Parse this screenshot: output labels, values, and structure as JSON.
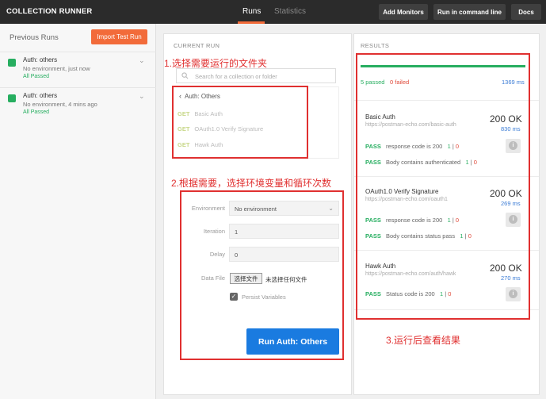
{
  "app": {
    "title": "COLLECTION RUNNER"
  },
  "tabs": {
    "runs": "Runs",
    "statistics": "Statistics"
  },
  "top_buttons": {
    "add_monitors": "Add Monitors",
    "run_cmd": "Run in command line",
    "docs": "Docs"
  },
  "sidebar": {
    "heading": "Previous Runs",
    "import_label": "Import Test Run",
    "runs": [
      {
        "name": "Auth: others",
        "env": "No environment, just now",
        "status": "All Passed"
      },
      {
        "name": "Auth: others",
        "env": "No environment, 4 mins ago",
        "status": "All Passed"
      }
    ]
  },
  "current_run": {
    "label": "CURRENT RUN",
    "search_placeholder": "Search for a collection or folder",
    "folder": "Auth: Others",
    "requests": [
      {
        "method": "GET",
        "name": "Basic Auth"
      },
      {
        "method": "GET",
        "name": "OAuth1.0 Verify Signature"
      },
      {
        "method": "GET",
        "name": "Hawk Auth"
      }
    ],
    "form": {
      "environment_label": "Environment",
      "environment_value": "No environment",
      "iteration_label": "Iteration",
      "iteration_value": "1",
      "delay_label": "Delay",
      "delay_value": "0",
      "datafile_label": "Data File",
      "choose_file": "选择文件",
      "no_file": "未选择任何文件",
      "persist_label": "Persist Variables",
      "persist_checked": true
    },
    "run_button": "Run Auth: Others"
  },
  "results": {
    "label": "RESULTS",
    "passed": "5 passed",
    "failed": "0 failed",
    "total_time": "1369 ms",
    "items": [
      {
        "name": "Basic Auth",
        "url": "https://postman-echo.com/basic-auth",
        "code": "200 OK",
        "time": "830 ms",
        "tests": [
          {
            "status": "PASS",
            "name": "response code is 200",
            "pass_count": "1",
            "fail_count": "0"
          },
          {
            "status": "PASS",
            "name": "Body contains authenticated",
            "pass_count": "1",
            "fail_count": "0"
          }
        ]
      },
      {
        "name": "OAuth1.0 Verify Signature",
        "url": "https://postman-echo.com/oauth1",
        "code": "200 OK",
        "time": "269 ms",
        "tests": [
          {
            "status": "PASS",
            "name": "response code is 200",
            "pass_count": "1",
            "fail_count": "0"
          },
          {
            "status": "PASS",
            "name": "Body contains status pass",
            "pass_count": "1",
            "fail_count": "0"
          }
        ]
      },
      {
        "name": "Hawk Auth",
        "url": "https://postman-echo.com/auth/hawk",
        "code": "200 OK",
        "time": "270 ms",
        "tests": [
          {
            "status": "PASS",
            "name": "Status code is 200",
            "pass_count": "1",
            "fail_count": "0"
          }
        ]
      }
    ]
  },
  "annotations": {
    "step1": "1.选择需要运行的文件夹",
    "step2": "2.根据需要，选择环境变量和循环次数",
    "step3": "3.运行后查看结果"
  },
  "colors": {
    "accent": "#f26b3a",
    "pass": "#27ae60",
    "fail": "#e04a3a",
    "primary": "#1a7be0",
    "annotation": "#e03030"
  }
}
